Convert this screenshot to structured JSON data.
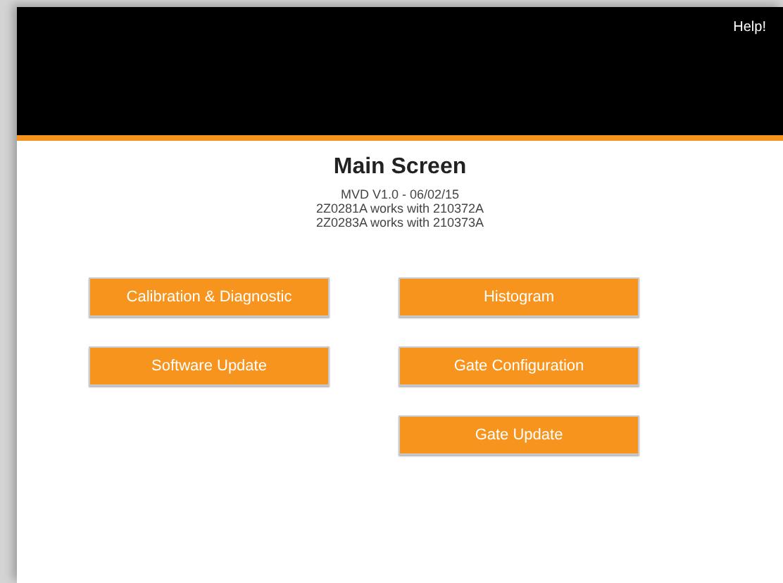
{
  "header": {
    "help_link": "Help!"
  },
  "title": "Main Screen",
  "info_lines": [
    "MVD V1.0 - 06/02/15",
    "2Z0281A works with 210372A",
    "2Z0283A works with 210373A"
  ],
  "left_buttons": [
    "Calibration & Diagnostic",
    "Software Update"
  ],
  "right_buttons": [
    "Histogram",
    "Gate Configuration",
    "Gate Update"
  ]
}
